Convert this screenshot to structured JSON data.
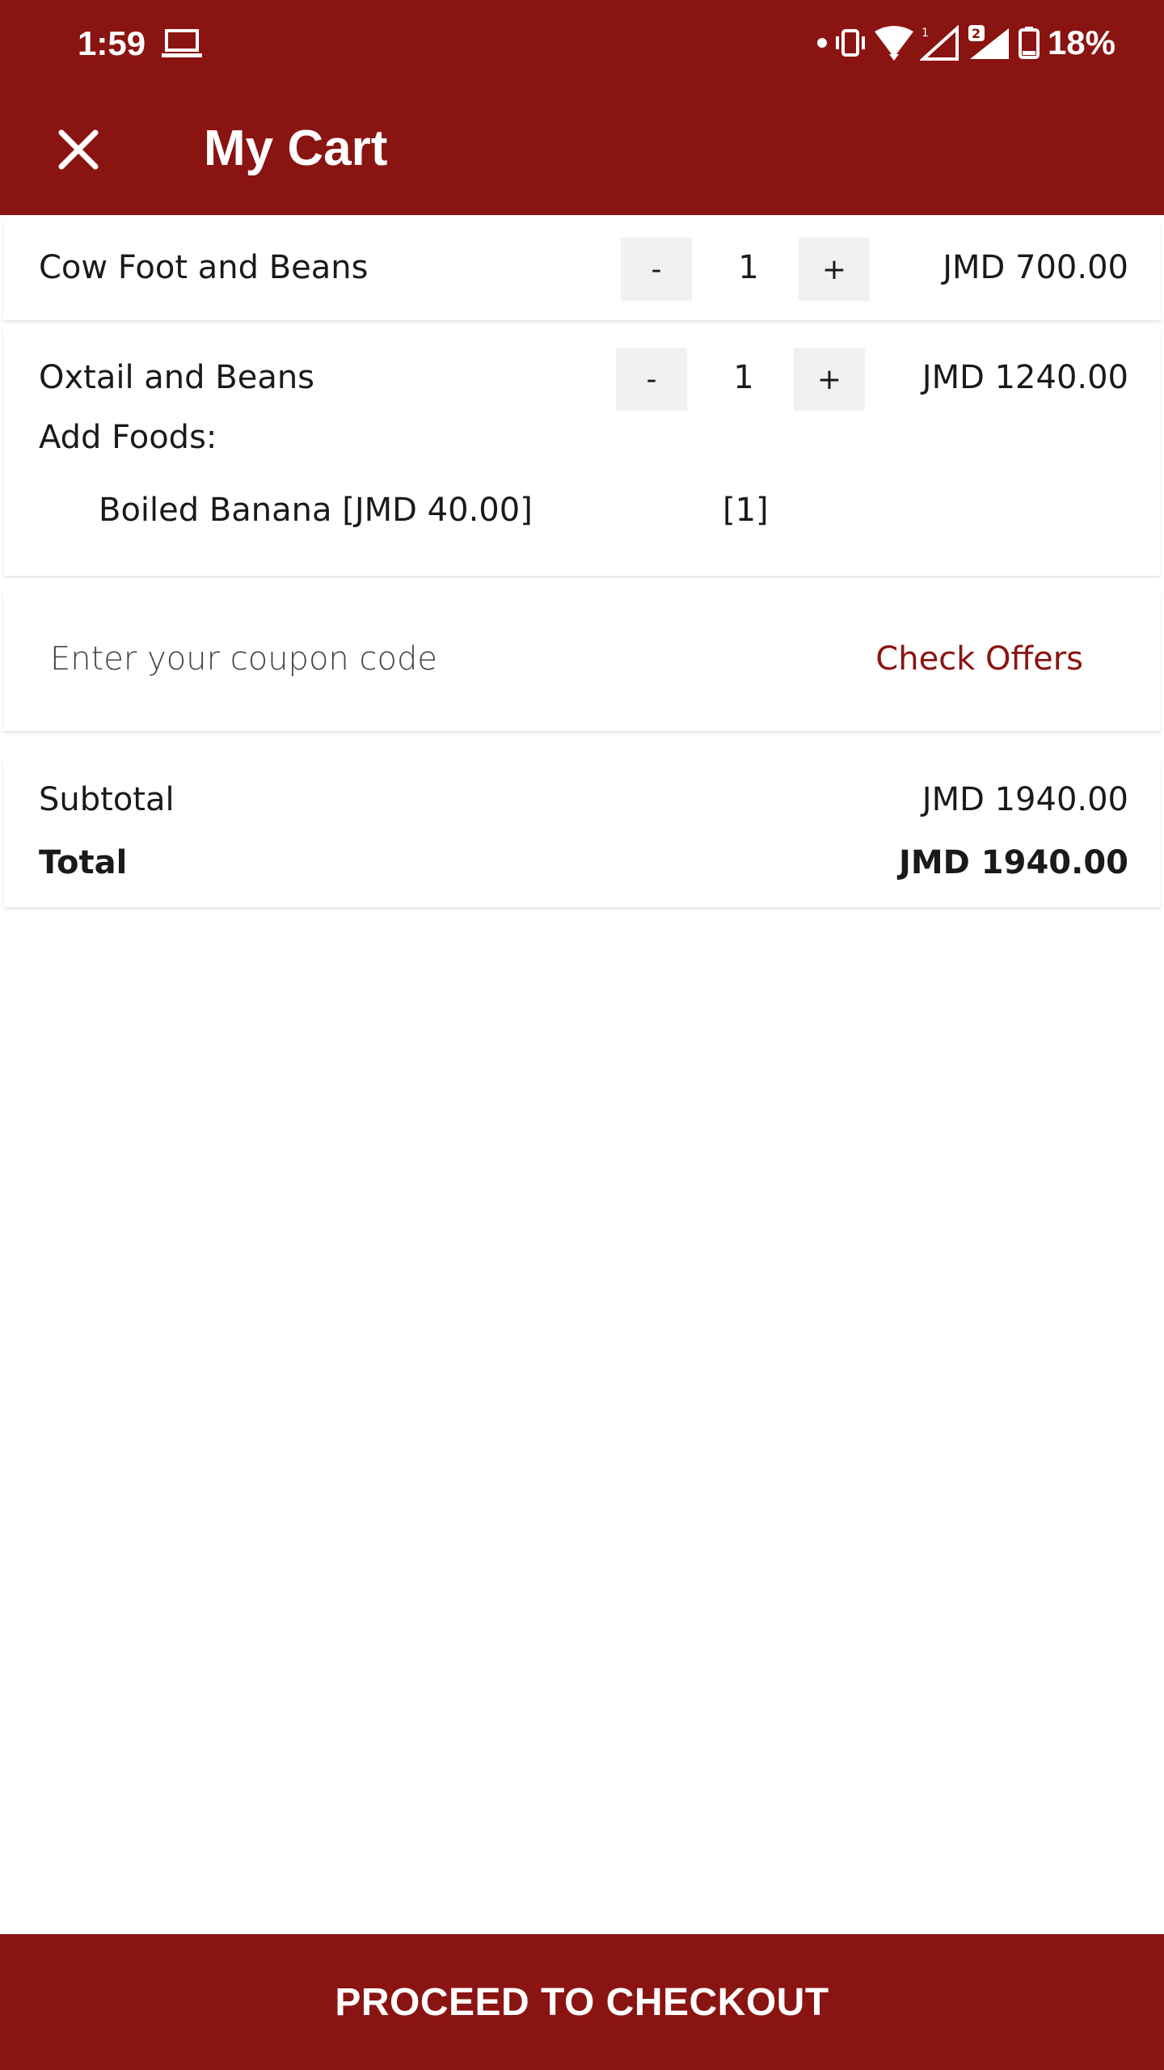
{
  "status_bar": {
    "time": "1:59",
    "battery": "18%",
    "icons": [
      "laptop-icon",
      "dot-icon",
      "vibrate-icon",
      "wifi-icon",
      "signal-1-icon",
      "signal-2-icon",
      "battery-icon"
    ]
  },
  "app_bar": {
    "title": "My Cart",
    "close_icon": "close-icon"
  },
  "cart": {
    "items": [
      {
        "name": "Cow Foot and Beans",
        "quantity": "1",
        "price": "JMD 700.00",
        "minus_label": "-",
        "plus_label": "+"
      },
      {
        "name": "Oxtail and Beans",
        "quantity": "1",
        "price": "JMD 1240.00",
        "minus_label": "-",
        "plus_label": "+",
        "addons_label": "Add Foods:",
        "addons": [
          {
            "name": "Boiled Banana [JMD 40.00]",
            "quantity": "[1]"
          }
        ]
      }
    ]
  },
  "coupon": {
    "placeholder": "Enter your coupon code",
    "action": "Check Offers"
  },
  "summary": {
    "subtotal_label": "Subtotal",
    "subtotal_value": "JMD 1940.00",
    "total_label": "Total",
    "total_value": "JMD 1940.00"
  },
  "checkout": {
    "label": "PROCEED TO CHECKOUT"
  },
  "colors": {
    "brand": "#8a1412",
    "qty_button_bg": "#f1f1f1"
  }
}
